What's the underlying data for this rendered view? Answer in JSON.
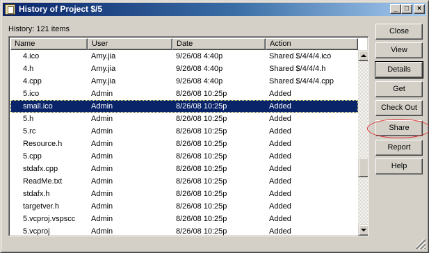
{
  "window": {
    "title": "History of Project $/5",
    "minimize_glyph": "_",
    "maximize_glyph": "□",
    "close_glyph": "×"
  },
  "history_label": "History: 121 items",
  "table": {
    "columns": [
      "Name",
      "User",
      "Date",
      "Action"
    ],
    "rows": [
      {
        "name": "4.ico",
        "user": "Amy.jia",
        "date": "9/26/08  4:40p",
        "action": "Shared $/4/4/4.ico"
      },
      {
        "name": "4.h",
        "user": "Amy.jia",
        "date": "9/26/08  4:40p",
        "action": "Shared $/4/4/4.h"
      },
      {
        "name": "4.cpp",
        "user": "Amy.jia",
        "date": "9/26/08  4:40p",
        "action": "Shared $/4/4/4.cpp"
      },
      {
        "name": "5.ico",
        "user": "Admin",
        "date": "8/26/08 10:25p",
        "action": "Added"
      },
      {
        "name": "small.ico",
        "user": "Admin",
        "date": "8/26/08 10:25p",
        "action": "Added",
        "selected": true
      },
      {
        "name": "5.h",
        "user": "Admin",
        "date": "8/26/08 10:25p",
        "action": "Added"
      },
      {
        "name": "5.rc",
        "user": "Admin",
        "date": "8/26/08 10:25p",
        "action": "Added"
      },
      {
        "name": "Resource.h",
        "user": "Admin",
        "date": "8/26/08 10:25p",
        "action": "Added"
      },
      {
        "name": "5.cpp",
        "user": "Admin",
        "date": "8/26/08 10:25p",
        "action": "Added"
      },
      {
        "name": "stdafx.cpp",
        "user": "Admin",
        "date": "8/26/08 10:25p",
        "action": "Added"
      },
      {
        "name": "ReadMe.txt",
        "user": "Admin",
        "date": "8/26/08 10:25p",
        "action": "Added"
      },
      {
        "name": "stdafx.h",
        "user": "Admin",
        "date": "8/26/08 10:25p",
        "action": "Added"
      },
      {
        "name": "targetver.h",
        "user": "Admin",
        "date": "8/26/08 10:25p",
        "action": "Added"
      },
      {
        "name": "5.vcproj.vspscc",
        "user": "Admin",
        "date": "8/26/08 10:25p",
        "action": "Added"
      },
      {
        "name": "5.vcproj",
        "user": "Admin",
        "date": "8/26/08 10:25p",
        "action": "Added"
      }
    ]
  },
  "buttons": {
    "close": "Close",
    "view": "View",
    "details": "Details",
    "get": "Get",
    "check_out": "Check Out",
    "share": "Share",
    "report": "Report",
    "help": "Help"
  },
  "colors": {
    "selection": "#0a246a",
    "annotation_circle": "#e03030"
  }
}
